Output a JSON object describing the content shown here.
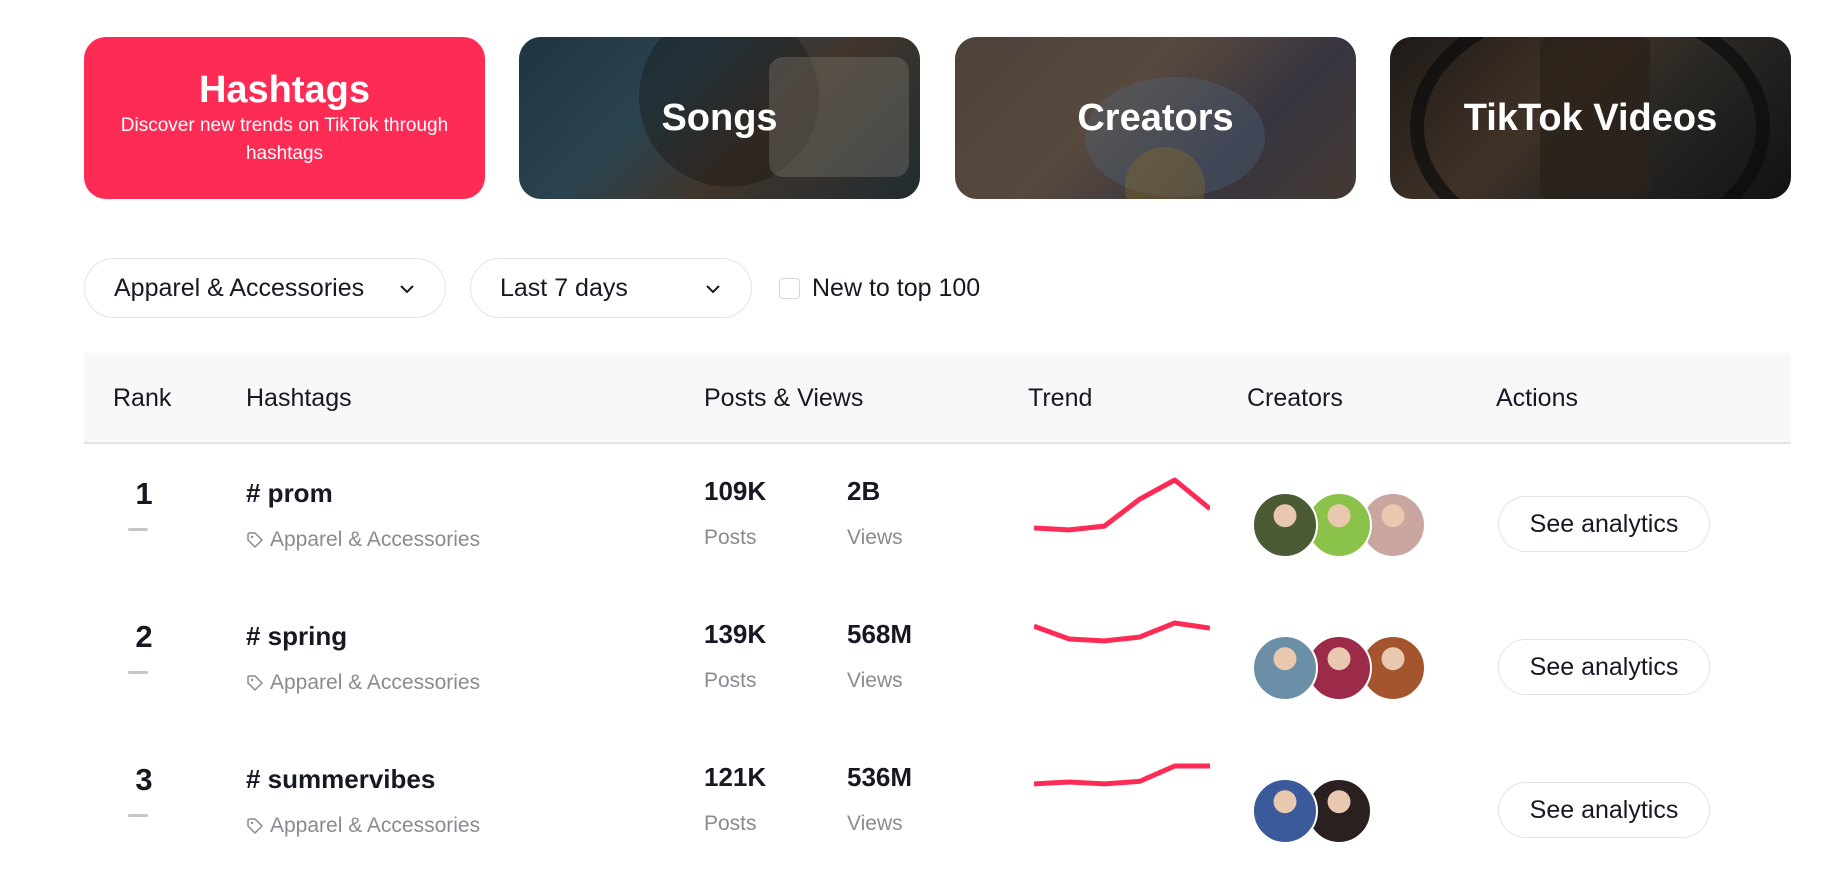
{
  "cards": [
    {
      "title": "Hashtags",
      "subtitle": "Discover new trends on TikTok through hashtags",
      "active": true
    },
    {
      "title": "Songs"
    },
    {
      "title": "Creators"
    },
    {
      "title": "TikTok Videos"
    }
  ],
  "filters": {
    "industry": "Apparel & Accessories",
    "period": "Last 7 days",
    "new_to_top_label": "New to top 100",
    "new_to_top_checked": false
  },
  "table": {
    "headers": [
      "Rank",
      "Hashtags",
      "Posts & Views",
      "Trend",
      "Creators",
      "Actions"
    ],
    "rows": [
      {
        "rank": "1",
        "hashtag": "# prom",
        "category": "Apparel & Accessories",
        "posts": "109K",
        "posts_label": "Posts",
        "views": "2B",
        "views_label": "Views",
        "trend": [
          0.25,
          0.22,
          0.28,
          0.7,
          1.0,
          0.55
        ],
        "creators": 3,
        "action": "See analytics"
      },
      {
        "rank": "2",
        "hashtag": "# spring",
        "category": "Apparel & Accessories",
        "posts": "139K",
        "posts_label": "Posts",
        "views": "568M",
        "views_label": "Views",
        "trend": [
          0.95,
          0.75,
          0.72,
          0.78,
          1.0,
          0.92
        ],
        "creators": 3,
        "action": "See analytics"
      },
      {
        "rank": "3",
        "hashtag": "# summervibes",
        "category": "Apparel & Accessories",
        "posts": "121K",
        "posts_label": "Posts",
        "views": "536M",
        "views_label": "Views",
        "trend": [
          0.72,
          0.75,
          0.72,
          0.76,
          1.0,
          1.0
        ],
        "creators": 2,
        "action": "See analytics"
      }
    ]
  },
  "colors": {
    "accent": "#fe2c55",
    "text": "#161823",
    "muted": "#8a8b91"
  }
}
